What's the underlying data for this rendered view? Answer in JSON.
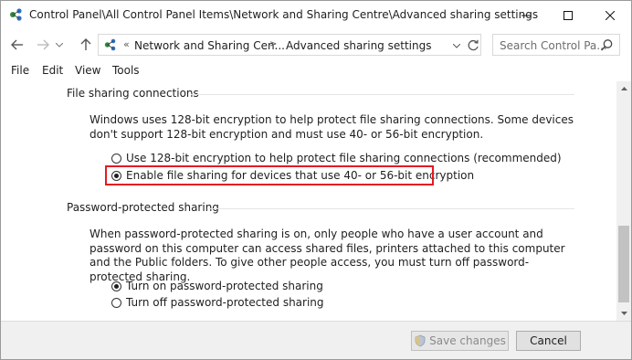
{
  "window": {
    "title": "Control Panel\\All Control Panel Items\\Network and Sharing Centre\\Advanced sharing settings"
  },
  "address": {
    "overflow_chevron": "«",
    "segment1": "Network and Sharing Cen...",
    "separator": ">",
    "segment2": "Advanced sharing settings"
  },
  "search": {
    "placeholder": "Search Control Pa..."
  },
  "menu": [
    "File",
    "Edit",
    "View",
    "Tools"
  ],
  "sections": {
    "file_sharing": {
      "header": "File sharing connections",
      "description": "Windows uses 128-bit encryption to help protect file sharing connections. Some devices don't support 128-bit encryption and must use 40- or 56-bit encryption.",
      "option1": "Use 128-bit encryption to help protect file sharing connections (recommended)",
      "option2": "Enable file sharing for devices that use 40- or 56-bit encryption",
      "selected": "option2"
    },
    "password_sharing": {
      "header": "Password-protected sharing",
      "description": "When password-protected sharing is on, only people who have a user account and password on this computer can access shared files, printers attached to this computer and the Public folders. To give other people access, you must turn off password-protected sharing.",
      "option1": "Turn on password-protected sharing",
      "option2": "Turn off password-protected sharing",
      "selected": "option1"
    }
  },
  "buttons": {
    "save": "Save changes",
    "cancel": "Cancel"
  },
  "colors": {
    "highlight": "#e31b23",
    "bottom_bar": "#f0f0f0"
  }
}
